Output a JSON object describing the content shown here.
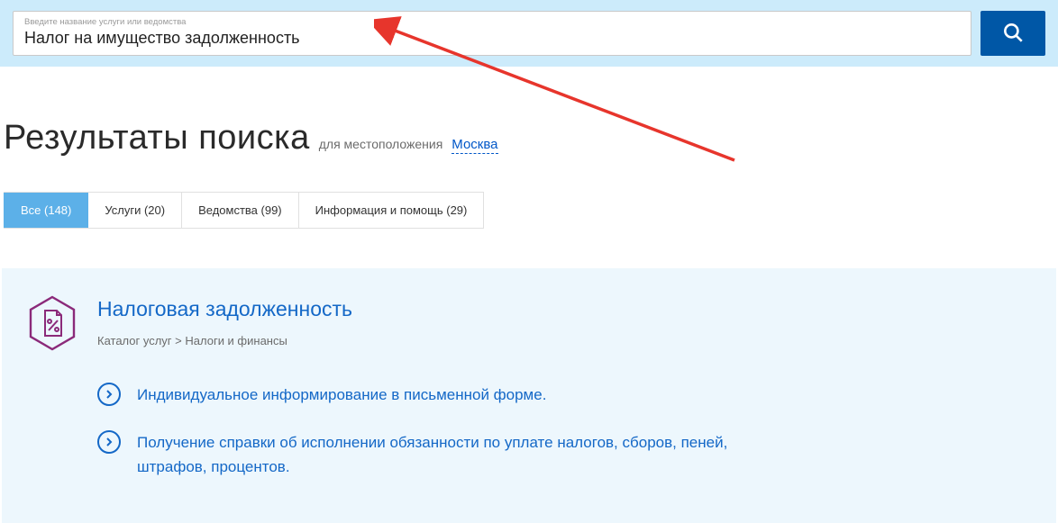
{
  "search": {
    "label": "Введите название услуги или ведомства",
    "value": "Налог на имущество задолженность"
  },
  "heading": {
    "title": "Результаты поиска",
    "location_prefix": "для местоположения",
    "location": "Москва"
  },
  "tabs": [
    {
      "label": "Все (148)",
      "active": true
    },
    {
      "label": "Услуги (20)",
      "active": false
    },
    {
      "label": "Ведомства (99)",
      "active": false
    },
    {
      "label": "Информация и помощь (29)",
      "active": false
    }
  ],
  "result": {
    "title": "Налоговая задолженность",
    "breadcrumb": "Каталог услуг > Налоги и финансы",
    "links": [
      "Индивидуальное информирование в письменной форме.",
      "Получение справки об исполнении обязанности по уплате налогов, сборов, пеней, штрафов, процентов."
    ]
  },
  "colors": {
    "accent_blue": "#1468c7",
    "search_btn": "#0057a6",
    "card_bg": "#edf7fd",
    "tab_active": "#5cb0e8",
    "icon_purple": "#8b2a7a",
    "arrow_red": "#e7352c"
  }
}
